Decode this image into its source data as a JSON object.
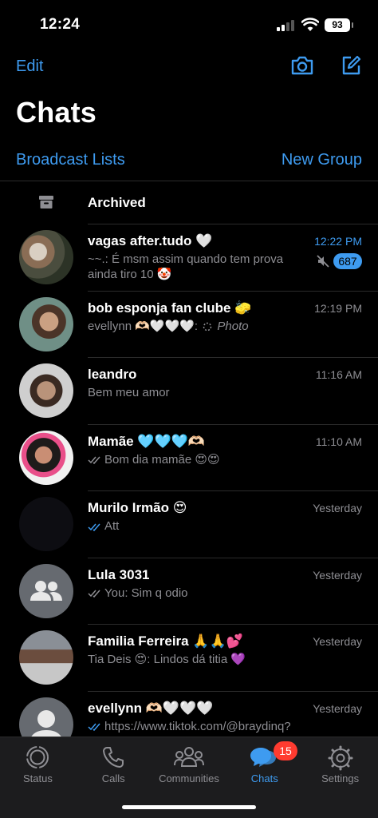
{
  "status_bar": {
    "time": "12:24",
    "battery": "93"
  },
  "header": {
    "edit_label": "Edit",
    "camera_icon": "camera-icon",
    "compose_icon": "compose-icon",
    "title": "Chats",
    "broadcast_label": "Broadcast Lists",
    "new_group_label": "New Group"
  },
  "archived": {
    "label": "Archived",
    "icon": "archive-icon"
  },
  "chats": [
    {
      "name": "vagas after.tudo 🤍",
      "time": "12:22 PM",
      "time_unread": true,
      "preview": "~~.: É msm assim quando tem prova ainda tiro 10 🤡",
      "muted": true,
      "unread_count": "687",
      "avatar": "photo"
    },
    {
      "name": "bob esponja fan clube 🧽",
      "time": "12:19 PM",
      "preview_sender": "evellynn 🫶🏻🤍🤍🤍:",
      "preview_media_label": "Photo",
      "avatar": "photo"
    },
    {
      "name": "leandro",
      "time": "11:16 AM",
      "preview": "Bem meu amor",
      "avatar": "photo"
    },
    {
      "name": "Mamãe 🩵🩵🩵🫶🏻",
      "time": "11:10 AM",
      "preview": "Bom dia mamãe 😍😍",
      "ticks": "delivered",
      "avatar": "photo"
    },
    {
      "name": "Murilo Irmão 😍",
      "time": "Yesterday",
      "preview": "Att",
      "ticks": "read",
      "avatar": "dark"
    },
    {
      "name": "Lula 3031",
      "time": "Yesterday",
      "preview": "You: Sim q odio",
      "ticks": "delivered",
      "avatar": "group"
    },
    {
      "name": "Familia Ferreira 🙏🙏💕",
      "time": "Yesterday",
      "preview": "Tia Deis 😍: Lindos dá titia 💜",
      "avatar": "photo"
    },
    {
      "name": "evellynn 🫶🏻🤍🤍🤍",
      "time": "Yesterday",
      "preview": "https://www.tiktok.com/@braydinq?",
      "ticks": "read",
      "avatar": "person"
    }
  ],
  "tabs": [
    {
      "label": "Status",
      "icon": "status-icon"
    },
    {
      "label": "Calls",
      "icon": "phone-icon"
    },
    {
      "label": "Communities",
      "icon": "communities-icon"
    },
    {
      "label": "Chats",
      "icon": "chats-icon",
      "badge": "15",
      "active": true
    },
    {
      "label": "Settings",
      "icon": "gear-icon"
    }
  ],
  "colors": {
    "accent": "#3e9bf0",
    "badge_red": "#ff3b30",
    "background": "#000000"
  }
}
